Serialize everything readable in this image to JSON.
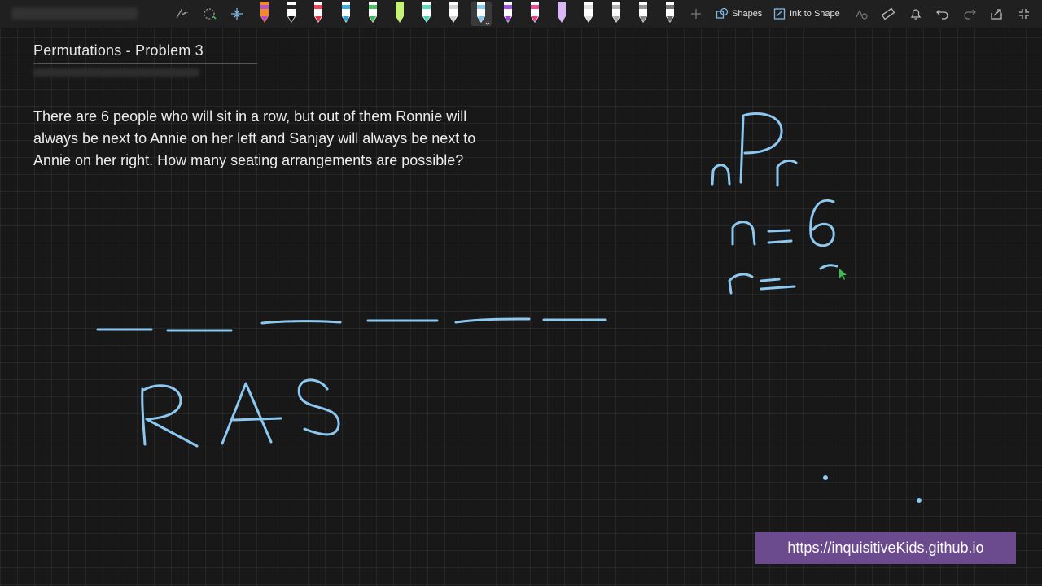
{
  "toolbar": {
    "shapes_label": "Shapes",
    "ink_to_shape_label": "Ink to Shape",
    "icons": [
      "lasso-select-icon",
      "lasso-select-icon",
      "add-space-icon",
      "pen-icon",
      "shapes-icon",
      "ink-to-shape-icon",
      "ink-to-math-icon",
      "ruler-icon",
      "bell-icon",
      "undo-icon",
      "redo-icon",
      "share-icon",
      "fullscreen-icon"
    ],
    "pens": [
      {
        "color": "#f28c28",
        "tip": "#b04fd6"
      },
      {
        "color": "#ffffff",
        "tip": "#111111"
      },
      {
        "color": "#ffffff",
        "tip": "#e8314a"
      },
      {
        "color": "#ffffff",
        "tip": "#29a3d9"
      },
      {
        "color": "#ffffff",
        "tip": "#3cba54"
      },
      {
        "color": "#c7f27a",
        "tip": "#c7f27a"
      },
      {
        "color": "#ffffff",
        "tip": "#49d6b5"
      },
      {
        "color": "#ffffff",
        "tip": "#cfcfcf"
      },
      {
        "color": "#ffffff",
        "tip": "#7ec8f0",
        "active": true
      },
      {
        "color": "#ffffff",
        "tip": "#9b3fe0"
      },
      {
        "color": "#ffffff",
        "tip": "#e83a8f"
      },
      {
        "color": "#d9b8f5",
        "tip": "#d9b8f5"
      },
      {
        "color": "#ffffff",
        "tip": "#dddddd"
      },
      {
        "color": "#ffffff",
        "tip": "#aaaaaa"
      },
      {
        "color": "#ffffff",
        "tip": "#888888"
      },
      {
        "color": "#ffffff",
        "tip": "#666666"
      }
    ]
  },
  "page": {
    "title": "Permutations - Problem 3",
    "problem_text": "There are 6 people who will sit in a row, but out of them Ronnie will always be next to Annie on her left and Sanjay will always be next to Annie on her right. How many seating arrangements are possible?"
  },
  "ink": {
    "color": "#8cc8f0",
    "letters": "RAS",
    "formula": "nPr",
    "n_line": "n = 6",
    "r_line": "r ="
  },
  "footer": {
    "url": "https://inquisitiveKids.github.io"
  },
  "colors": {
    "background": "#181818",
    "toolbar": "#202020",
    "ink": "#8cc8f0",
    "url_box": "#6b4a8e"
  }
}
